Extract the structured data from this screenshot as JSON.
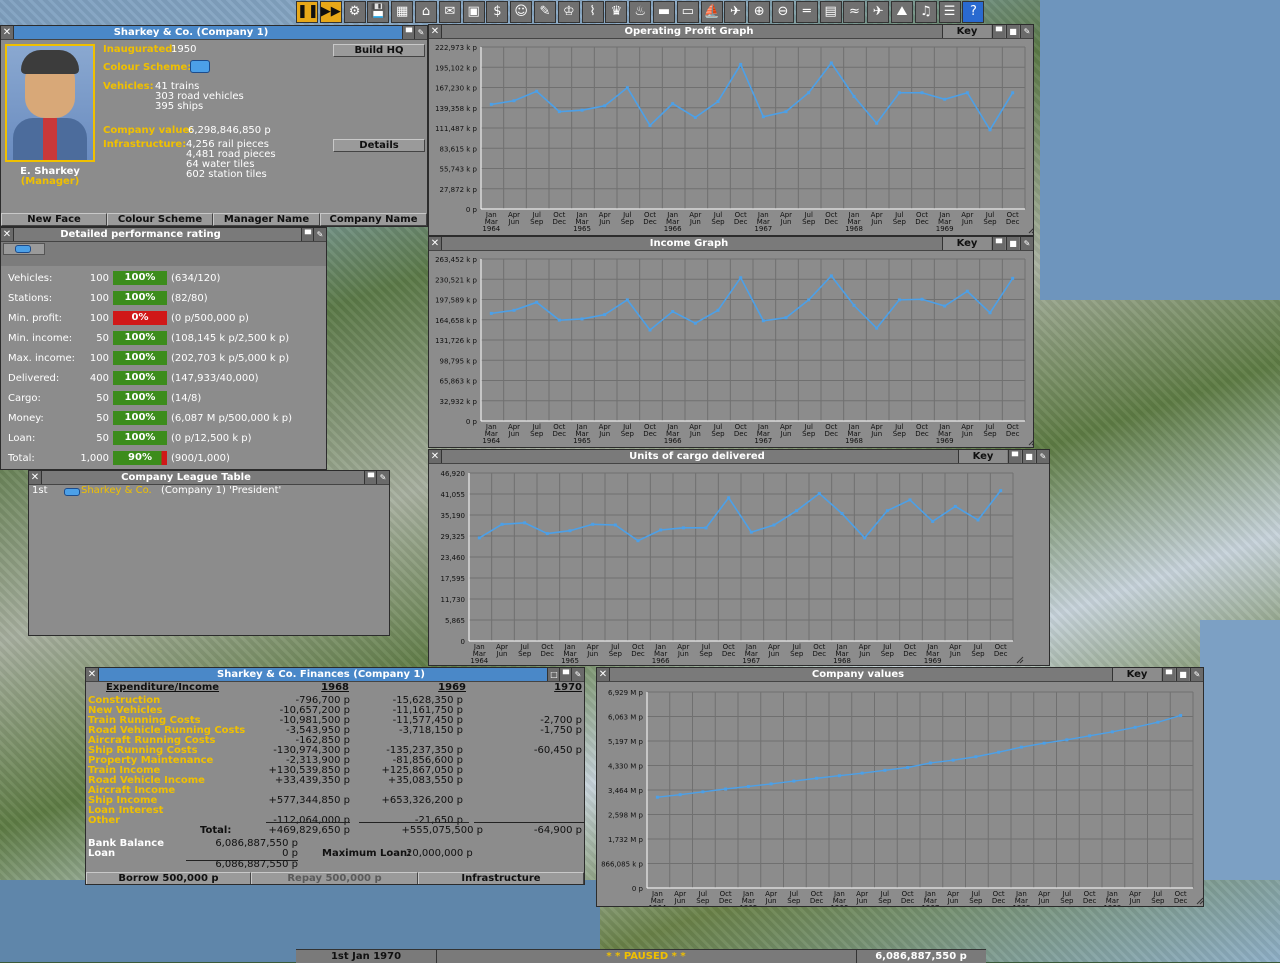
{
  "toolbar": {
    "tools": [
      "pause-icon",
      "fast-forward-icon",
      "settings-icon",
      "save-icon",
      "map-icon",
      "town-directory-icon",
      "subsidies-icon",
      "stations-icon",
      "finances-icon",
      "company-icon",
      "stories-icon",
      "goals-icon",
      "graphs-icon",
      "league-icon",
      "industries-icon",
      "trains-icon",
      "road-vehicles-icon",
      "ships-icon",
      "aircraft-icon",
      "zoom-in-icon",
      "zoom-out-icon",
      "build-rail-icon",
      "build-road-icon",
      "build-water-icon",
      "build-air-icon",
      "landscape-icon",
      "music-icon",
      "newspaper-icon",
      "help-icon"
    ]
  },
  "company": {
    "title": "Sharkey & Co. (Company 1)",
    "inaugurated_label": "Inaugurated:",
    "inaugurated_value": "1950",
    "colour_scheme_label": "Colour Scheme:",
    "vehicles_label": "Vehicles:",
    "vehicles": [
      "41 trains",
      "303 road vehicles",
      "395 ships"
    ],
    "value_label": "Company value:",
    "value": "6,298,846,850 p",
    "infra_label": "Infrastructure:",
    "infra": [
      "4,256 rail pieces",
      "4,481 road pieces",
      "64 water tiles",
      "602 station tiles"
    ],
    "manager_name": "E. Sharkey",
    "manager_title": "(Manager)",
    "build_hq": "Build HQ",
    "details": "Details",
    "buttons": [
      "New Face",
      "Colour Scheme",
      "Manager Name",
      "Company Name"
    ]
  },
  "performance": {
    "title": "Detailed performance rating",
    "rows": [
      {
        "label": "Vehicles:",
        "weight": "100",
        "pct": "100%",
        "value": "(634/120)",
        "fill": 1.0
      },
      {
        "label": "Stations:",
        "weight": "100",
        "pct": "100%",
        "value": "(82/80)",
        "fill": 1.0
      },
      {
        "label": "Min. profit:",
        "weight": "100",
        "pct": "0%",
        "value": "(0 p/500,000 p)",
        "fill": 0.0
      },
      {
        "label": "Min. income:",
        "weight": "50",
        "pct": "100%",
        "value": "(108,145 k p/2,500 k p)",
        "fill": 1.0
      },
      {
        "label": "Max. income:",
        "weight": "100",
        "pct": "100%",
        "value": "(202,703 k p/5,000 k p)",
        "fill": 1.0
      },
      {
        "label": "Delivered:",
        "weight": "400",
        "pct": "100%",
        "value": "(147,933/40,000)",
        "fill": 1.0
      },
      {
        "label": "Cargo:",
        "weight": "50",
        "pct": "100%",
        "value": "(14/8)",
        "fill": 1.0
      },
      {
        "label": "Money:",
        "weight": "50",
        "pct": "100%",
        "value": "(6,087 M p/500,000 k p)",
        "fill": 1.0
      },
      {
        "label": "Loan:",
        "weight": "50",
        "pct": "100%",
        "value": "(0 p/12,500 k p)",
        "fill": 1.0
      },
      {
        "label": "Total:",
        "weight": "1,000",
        "pct": "90%",
        "value": "(900/1,000)",
        "fill": 0.9
      }
    ]
  },
  "league": {
    "title": "Company League Table",
    "rank": "1st",
    "name": "Sharkey & Co.",
    "desc": "(Company 1) 'President'"
  },
  "graphs": {
    "key_label": "Key",
    "operating_title": "Operating Profit Graph",
    "income_title": "Income Graph",
    "cargo_title": "Units of cargo delivered",
    "values_title": "Company values"
  },
  "finances": {
    "title": "Sharkey & Co. Finances (Company 1)",
    "header": "Expenditure/Income",
    "years": [
      "1968",
      "1969",
      "1970"
    ],
    "categories": [
      "Construction",
      "New Vehicles",
      "Train Running Costs",
      "Road Vehicle Running Costs",
      "Aircraft Running Costs",
      "Ship Running Costs",
      "Property Maintenance",
      "Train Income",
      "Road Vehicle Income",
      "Aircraft Income",
      "Ship Income",
      "Loan Interest",
      "Other"
    ],
    "col1968": [
      "-796,700 p",
      "-10,657,200 p",
      "-10,981,500 p",
      "-3,543,950 p",
      "-162,850 p",
      "-130,974,300 p",
      "-2,313,900 p",
      "+130,539,850 p",
      "+33,439,350 p",
      "",
      "+577,344,850 p",
      "",
      "-112,064,000 p"
    ],
    "col1969": [
      "-15,628,350 p",
      "-11,161,750 p",
      "-11,577,450 p",
      "-3,718,150 p",
      "",
      "-135,237,350 p",
      "-81,856,600 p",
      "+125,867,050 p",
      "+35,083,550 p",
      "",
      "+653,326,200 p",
      "",
      "-21,650 p"
    ],
    "col1970": [
      "",
      "",
      "-2,700 p",
      "-1,750 p",
      "",
      "-60,450 p",
      "",
      "",
      "",
      "",
      "",
      "",
      ""
    ],
    "total_label": "Total:",
    "totals": [
      "+469,829,650 p",
      "+555,075,500 p",
      "-64,900 p"
    ],
    "bank_balance_label": "Bank Balance",
    "bank_balance": "6,086,887,550 p",
    "loan_label": "Loan",
    "loan": "0 p",
    "net": "6,086,887,550 p",
    "max_loan_label": "Maximum Loan:",
    "max_loan": "20,000,000 p",
    "borrow": "Borrow 500,000 p",
    "repay": "Repay 500,000 p",
    "infrastructure": "Infrastructure"
  },
  "status": {
    "date": "1st Jan 1970",
    "paused": "* *  PAUSED  * *",
    "money": "6,086,887,550 p"
  },
  "chart_data": [
    {
      "type": "line",
      "title": "Operating Profit Graph",
      "x": [
        "Jan Mar 1964",
        "Apr Jun",
        "Jul Sep",
        "Oct Dec",
        "Jan Mar 1965",
        "Apr Jun",
        "Jul Sep",
        "Oct Dec",
        "Jan Mar 1966",
        "Apr Jun",
        "Jul Sep",
        "Oct Dec",
        "Jan Mar 1967",
        "Apr Jun",
        "Jul Sep",
        "Oct Dec",
        "Jan Mar 1968",
        "Apr Jun",
        "Jul Sep",
        "Oct Dec",
        "Jan Mar 1969",
        "Apr Jun",
        "Jul Sep",
        "Oct Dec"
      ],
      "yticks": [
        "0 p",
        "27,872 k p",
        "55,743 k p",
        "83,615 k p",
        "111,487 k p",
        "139,358 k p",
        "167,230 k p",
        "195,102 k p",
        "222,973 k p"
      ],
      "ylim": [
        0,
        222973
      ],
      "values": [
        144000,
        149000,
        162000,
        134000,
        136000,
        142000,
        167000,
        115000,
        145000,
        126000,
        148000,
        199000,
        127000,
        134000,
        160000,
        201000,
        155000,
        118000,
        160000,
        160000,
        151000,
        160000,
        109000,
        160000
      ],
      "color": "#4ca0e8"
    },
    {
      "type": "line",
      "title": "Income Graph",
      "x": [
        "Jan Mar 1964",
        "Apr Jun",
        "Jul Sep",
        "Oct Dec",
        "Jan Mar 1965",
        "Apr Jun",
        "Jul Sep",
        "Oct Dec",
        "Jan Mar 1966",
        "Apr Jun",
        "Jul Sep",
        "Oct Dec",
        "Jan Mar 1967",
        "Apr Jun",
        "Jul Sep",
        "Oct Dec",
        "Jan Mar 1968",
        "Apr Jun",
        "Jul Sep",
        "Oct Dec",
        "Jan Mar 1969",
        "Apr Jun",
        "Jul Sep",
        "Oct Dec"
      ],
      "yticks": [
        "0 p",
        "32,932 k p",
        "65,863 k p",
        "98,795 k p",
        "131,726 k p",
        "164,658 k p",
        "197,589 k p",
        "230,521 k p",
        "263,452 k p"
      ],
      "ylim": [
        0,
        263452
      ],
      "values": [
        175000,
        180000,
        193000,
        164000,
        166000,
        173000,
        197000,
        148000,
        178000,
        159000,
        180000,
        233000,
        163000,
        168000,
        197000,
        236000,
        188000,
        151000,
        197000,
        198000,
        187000,
        211000,
        176000,
        232000
      ],
      "color": "#4ca0e8"
    },
    {
      "type": "line",
      "title": "Units of cargo delivered",
      "x": [
        "Jan Mar 1964",
        "Apr Jun",
        "Jul Sep",
        "Oct Dec",
        "Jan Mar 1965",
        "Apr Jun",
        "Jul Sep",
        "Oct Dec",
        "Jan Mar 1966",
        "Apr Jun",
        "Jul Sep",
        "Oct Dec",
        "Jan Mar 1967",
        "Apr Jun",
        "Jul Sep",
        "Oct Dec",
        "Jan Mar 1968",
        "Apr Jun",
        "Jul Sep",
        "Oct Dec",
        "Jan Mar 1969",
        "Apr Jun",
        "Jul Sep",
        "Oct Dec"
      ],
      "yticks": [
        "0",
        "5,865",
        "11,730",
        "17,595",
        "23,460",
        "29,325",
        "35,190",
        "41,055",
        "46,920"
      ],
      "ylim": [
        0,
        46920
      ],
      "values": [
        28800,
        32600,
        33000,
        30000,
        30800,
        32600,
        32400,
        28000,
        31000,
        31600,
        31600,
        40000,
        30400,
        32400,
        36400,
        41200,
        35600,
        28800,
        36400,
        39400,
        33400,
        37600,
        33800,
        42000
      ],
      "color": "#4ca0e8"
    },
    {
      "type": "line",
      "title": "Company values",
      "x": [
        "Jan Mar 1964",
        "Apr Jun",
        "Jul Sep",
        "Oct Dec",
        "Jan Mar 1965",
        "Apr Jun",
        "Jul Sep",
        "Oct Dec",
        "Jan Mar 1966",
        "Apr Jun",
        "Jul Sep",
        "Oct Dec",
        "Jan Mar 1967",
        "Apr Jun",
        "Jul Sep",
        "Oct Dec",
        "Jan Mar 1968",
        "Apr Jun",
        "Jul Sep",
        "Oct Dec",
        "Jan Mar 1969",
        "Apr Jun",
        "Jul Sep",
        "Oct Dec"
      ],
      "yticks": [
        "0 p",
        "866,085 k p",
        "1,732 M p",
        "2,598 M p",
        "3,464 M p",
        "4,330 M p",
        "5,197 M p",
        "6,063 M p",
        "6,929 M p"
      ],
      "ylim": [
        0,
        6929
      ],
      "values": [
        3210,
        3300,
        3400,
        3500,
        3590,
        3680,
        3780,
        3880,
        3970,
        4060,
        4160,
        4260,
        4420,
        4520,
        4640,
        4800,
        4980,
        5120,
        5240,
        5380,
        5520,
        5680,
        5860,
        6100
      ],
      "color": "#4ca0e8"
    }
  ]
}
